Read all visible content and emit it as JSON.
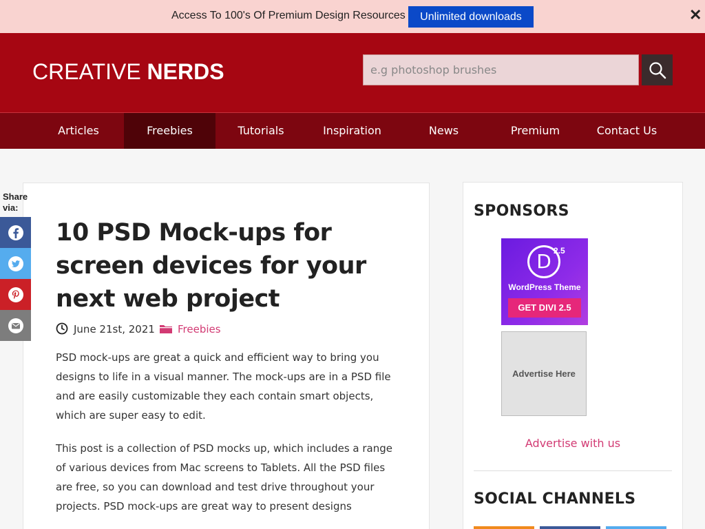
{
  "promo": {
    "text": "Access To 100's Of Premium Design Resources",
    "button_label": "Unlimited downloads",
    "close_label": "✕"
  },
  "header": {
    "logo_light": "CREATIVE ",
    "logo_bold": "NERDS",
    "search_placeholder": "e.g photoshop brushes"
  },
  "nav": {
    "items": [
      {
        "label": "Articles"
      },
      {
        "label": "Freebies"
      },
      {
        "label": "Tutorials"
      },
      {
        "label": "Inspiration"
      },
      {
        "label": "News"
      },
      {
        "label": "Premium"
      },
      {
        "label": "Contact Us"
      }
    ],
    "active": "Freebies"
  },
  "share": {
    "label": "Share via:",
    "buttons": [
      {
        "icon": "facebook-icon",
        "color": "#3b5998"
      },
      {
        "icon": "twitter-icon",
        "color": "#55acee"
      },
      {
        "icon": "pinterest-icon",
        "color": "#cb2027"
      },
      {
        "icon": "email-icon",
        "color": "#7d7d7d"
      }
    ]
  },
  "article": {
    "title": "10 PSD Mock-ups for screen devices for your next web project",
    "date": "June 21st, 2021",
    "category": "Freebies",
    "paragraphs": [
      "PSD mock-ups are great a quick and efficient way to bring you designs to life in a visual manner. The mock-ups are in a PSD file and are easily customizable they each contain smart objects, which are super easy to edit.",
      "This post is a collection of PSD mocks up, which includes a range of various devices from Mac screens to Tablets. All the PSD files are free, so you can download and test drive throughout your projects. PSD mock-ups are great way to present designs"
    ]
  },
  "sidebar": {
    "sponsors_heading": "SPONSORS",
    "divi_ad": {
      "logo_letter": "D",
      "version": "2.5",
      "subtitle": "WordPress Theme",
      "cta": "GET DIVI 2.5"
    },
    "advertise_box": "Advertise Here",
    "advertise_link": "Advertise with us",
    "social_heading": "SOCIAL CHANNELS"
  },
  "colors": {
    "brand_red": "#a60612",
    "nav_dark": "#7d0610",
    "accent_pink": "#d23a73",
    "promo_button": "#0b49c8"
  }
}
